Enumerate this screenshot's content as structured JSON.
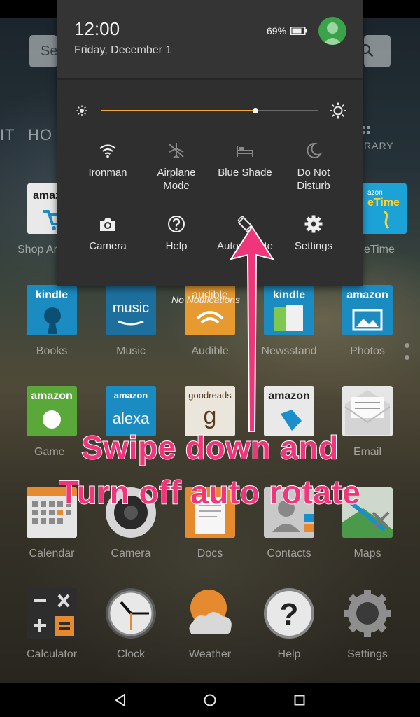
{
  "colors": {
    "shade_bg": "#2f2f2f",
    "slider_fill": "#f3a935",
    "annotation": "#f0357a",
    "avatar": "#3aa34a"
  },
  "status": {
    "time": "12:00",
    "date": "Friday, December 1",
    "battery": "69%"
  },
  "brightness": {
    "level": 0.71
  },
  "quick_settings": [
    {
      "label": "Ironman",
      "icon": "wifi-icon"
    },
    {
      "label": "Airplane\nMode",
      "icon": "airplane-off-icon"
    },
    {
      "label": "Blue Shade",
      "icon": "bed-icon"
    },
    {
      "label": "Do Not\nDisturb",
      "icon": "moon-icon"
    },
    {
      "label": "Camera",
      "icon": "camera-icon"
    },
    {
      "label": "Help",
      "icon": "help-icon"
    },
    {
      "label": "Auto-Rotate",
      "icon": "rotate-icon"
    },
    {
      "label": "Settings",
      "icon": "gear-icon"
    }
  ],
  "notifications": {
    "empty_text": "No Notifications"
  },
  "home": {
    "search_text": "Se",
    "nav_left": "IT",
    "nav_home": "HO",
    "nav_library": "RARY",
    "apps": [
      {
        "label": "Shop Ar"
      },
      {
        "label": "eTime"
      },
      {
        "label": "Books",
        "tile_text": "kindle"
      },
      {
        "label": "Music",
        "tile_text": "music"
      },
      {
        "label": "Audible",
        "tile_text": "audible"
      },
      {
        "label": "Newsstand",
        "tile_text": "kindle"
      },
      {
        "label": "Photos",
        "tile_text": "amazon"
      },
      {
        "label": "Game",
        "tile_text": "amazon"
      },
      {
        "label": "",
        "tile_text": "alexa",
        "tile_top": "amazon"
      },
      {
        "label": "",
        "tile_text": "g",
        "tile_top": "goodreads"
      },
      {
        "label": "",
        "tile_text": "amazon"
      },
      {
        "label": "Email"
      },
      {
        "label": "Calendar"
      },
      {
        "label": "Camera"
      },
      {
        "label": "Docs"
      },
      {
        "label": "Contacts"
      },
      {
        "label": "Maps"
      },
      {
        "label": "Calculator"
      },
      {
        "label": "Clock"
      },
      {
        "label": "Weather"
      },
      {
        "label": "Help"
      },
      {
        "label": "Settings"
      }
    ]
  },
  "annotation": {
    "line1": "Swipe down and",
    "line2": "Turn off auto rotate"
  },
  "navbar": {
    "back_icon": "back-triangle-icon",
    "home_icon": "home-circle-icon",
    "recents_icon": "recents-square-icon"
  }
}
